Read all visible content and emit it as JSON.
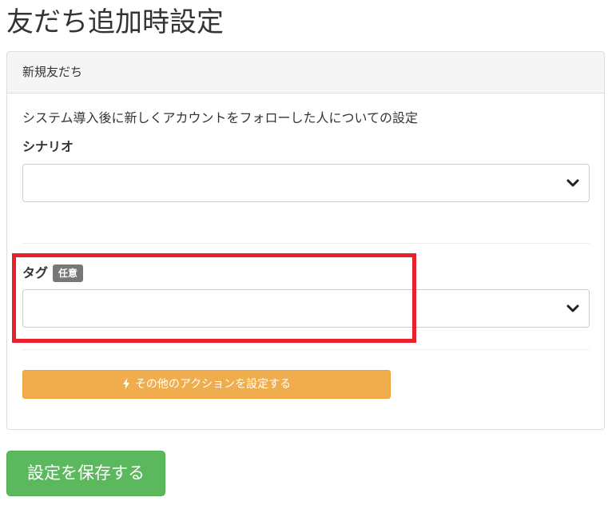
{
  "page": {
    "title": "友だち追加時設定"
  },
  "panel": {
    "heading": "新規友だち",
    "description": "システム導入後に新しくアカウントをフォローした人についての設定",
    "scenario": {
      "label": "シナリオ",
      "selected_value": ""
    },
    "tag": {
      "label": "タグ",
      "badge": "任意",
      "selected_value": ""
    },
    "action_button_label": "その他のアクションを設定する",
    "action_button_icon": "bolt-icon"
  },
  "save_button_label": "設定を保存する",
  "colors": {
    "warning_button": "#f0ad4e",
    "success_button": "#5cb85c",
    "highlight": "#e8202a",
    "badge": "#777777"
  }
}
